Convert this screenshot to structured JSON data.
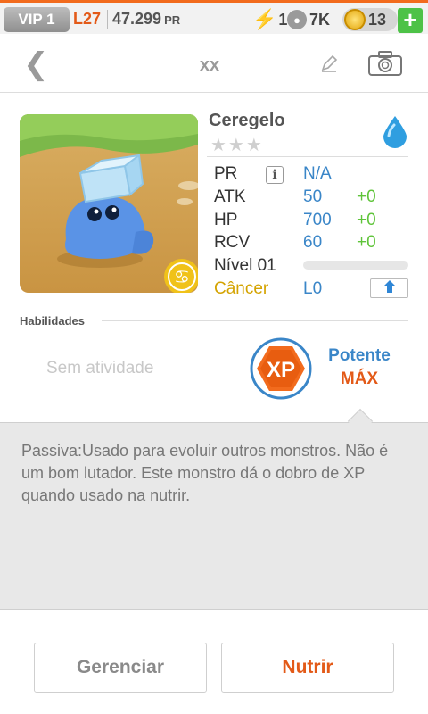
{
  "status_bar": {
    "vip": "VIP 1",
    "level": "L27",
    "power_value": "47.299",
    "power_unit": "PR",
    "stamina": "1",
    "food": "7K",
    "coins": "13",
    "add_label": "+"
  },
  "header": {
    "title": "xx"
  },
  "monster": {
    "name": "Ceregelo",
    "stars": "★★★",
    "element_icon": "water-drop-icon",
    "stats": {
      "pr_label": "PR",
      "pr_value": "N/A",
      "atk_label": "ATK",
      "atk_value": "50",
      "atk_bonus": "+0",
      "hp_label": "HP",
      "hp_value": "700",
      "hp_bonus": "+0",
      "rcv_label": "RCV",
      "rcv_value": "60",
      "rcv_bonus": "+0",
      "level_label": "Nível 01",
      "xp_progress": 0,
      "sign_label": "Câncer",
      "sign_level": "L0"
    }
  },
  "skills": {
    "heading": "Habilidades",
    "no_activity": "Sem atividade",
    "badge_text": "XP",
    "potency_label": "Potente",
    "potency_value": "MÁX"
  },
  "description": {
    "text": "Passiva:Usado para evoluir outros monstros. Não é um bom lutador. Este monstro dá o dobro de XP quando usado na nutrir."
  },
  "actions": {
    "manage_label": "Gerenciar",
    "feed_label": "Nutrir"
  },
  "colors": {
    "accent_orange": "#e35a18",
    "stat_blue": "#3a86c8",
    "bonus_green": "#5fc43a",
    "sign_gold": "#d4a300"
  }
}
